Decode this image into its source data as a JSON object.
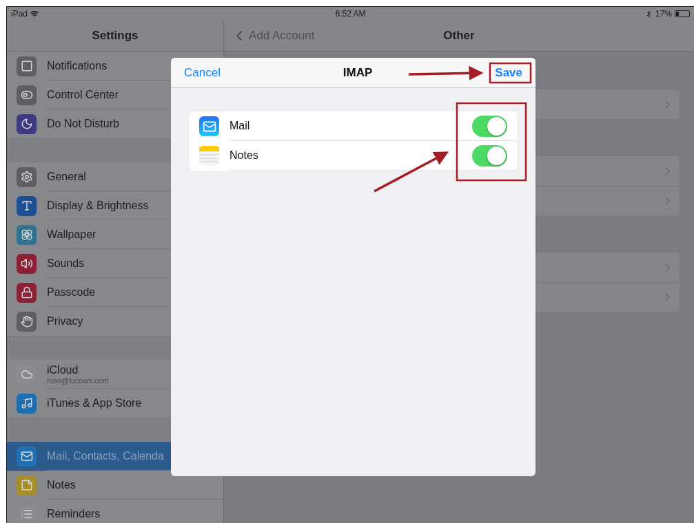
{
  "status_bar": {
    "device": "iPad",
    "time": "6:52 AM",
    "battery": "17%"
  },
  "sidebar": {
    "title": "Settings",
    "groups": [
      {
        "items": [
          {
            "label": "Notifications",
            "color": "#5e5f63",
            "selected": false
          },
          {
            "label": "Control Center",
            "color": "#5e5f63",
            "selected": false
          },
          {
            "label": "Do Not Disturb",
            "color": "#3e3a80",
            "selected": false
          }
        ]
      },
      {
        "items": [
          {
            "label": "General",
            "color": "#5e5f63",
            "selected": false
          },
          {
            "label": "Display & Brightness",
            "color": "#1d4f92",
            "selected": false
          },
          {
            "label": "Wallpaper",
            "color": "#2f7390",
            "selected": false
          },
          {
            "label": "Sounds",
            "color": "#8c2136",
            "selected": false
          },
          {
            "label": "Passcode",
            "color": "#8c2136",
            "selected": false
          },
          {
            "label": "Privacy",
            "color": "#5e5f63",
            "selected": false
          }
        ]
      },
      {
        "items": [
          {
            "label": "iCloud",
            "subtitle": "ross@tucows.com",
            "color": "#8a8b8f",
            "selected": false
          },
          {
            "label": "iTunes & App Store",
            "color": "#1e6fb0",
            "selected": false
          }
        ]
      },
      {
        "items": [
          {
            "label": "Mail, Contacts, Calenda",
            "color": "#1f70b0",
            "selected": true
          },
          {
            "label": "Notes",
            "color": "#a68f2a",
            "selected": false
          },
          {
            "label": "Reminders",
            "color": "#8a8b8f",
            "selected": false
          }
        ]
      }
    ]
  },
  "detail": {
    "back": "Add Account",
    "title": "Other",
    "sections": [
      {
        "rows": [
          {
            "kind": "disclosure"
          }
        ]
      },
      {
        "rows": [
          {
            "kind": "disclosure"
          },
          {
            "kind": "disclosure"
          }
        ]
      },
      {
        "rows": [
          {
            "kind": "disclosure"
          },
          {
            "kind": "disclosure"
          }
        ]
      }
    ]
  },
  "dialog": {
    "cancel": "Cancel",
    "title": "IMAP",
    "save": "Save",
    "services": [
      {
        "label": "Mail",
        "on": true
      },
      {
        "label": "Notes",
        "on": true
      }
    ]
  }
}
